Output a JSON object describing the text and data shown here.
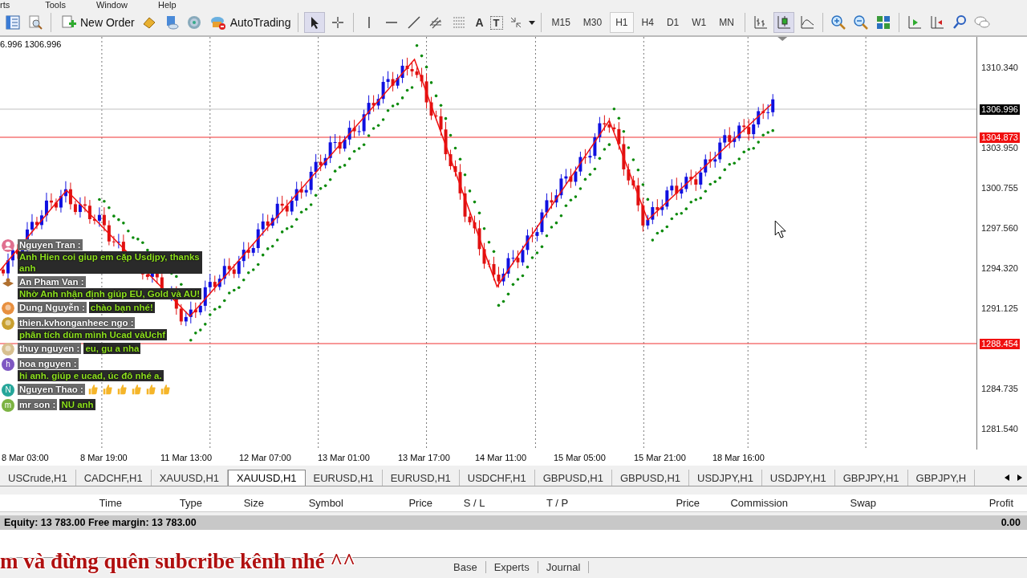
{
  "menu": [
    "rts",
    "Tools",
    "Window",
    "Help"
  ],
  "toolbar": {
    "new_order": "New Order",
    "autotrading": "AutoTrading",
    "text_tool": "A",
    "label_tool": "T",
    "timeframes": [
      {
        "label": "M15",
        "selected": false
      },
      {
        "label": "M30",
        "selected": false
      },
      {
        "label": "H1",
        "selected": true
      },
      {
        "label": "H4",
        "selected": false
      },
      {
        "label": "D1",
        "selected": false
      },
      {
        "label": "W1",
        "selected": false
      },
      {
        "label": "MN",
        "selected": false
      }
    ],
    "chart_modes": [
      {
        "kind": "bars",
        "selected": false
      },
      {
        "kind": "candles",
        "selected": true
      },
      {
        "kind": "line",
        "selected": false
      }
    ]
  },
  "chart": {
    "symbol_info": "6.996 1306.996",
    "price_labels": [
      {
        "kind": "tick",
        "text": "1310.340"
      },
      {
        "kind": "bid",
        "text": "1306.996"
      },
      {
        "kind": "level",
        "text": "1304.873"
      },
      {
        "kind": "tick",
        "text": "1303.950"
      },
      {
        "kind": "tick",
        "text": "1300.755"
      },
      {
        "kind": "tick",
        "text": "1297.560"
      },
      {
        "kind": "tick",
        "text": "1294.320"
      },
      {
        "kind": "tick",
        "text": "1291.125"
      },
      {
        "kind": "level",
        "text": "1288.454"
      },
      {
        "kind": "tick",
        "text": "1284.735"
      },
      {
        "kind": "tick",
        "text": "1281.540"
      }
    ],
    "time_labels": [
      "8 Mar 03:00",
      "8 Mar 19:00",
      "11 Mar 13:00",
      "12 Mar 07:00",
      "13 Mar 01:00",
      "13 Mar 17:00",
      "14 Mar 11:00",
      "15 Mar 05:00",
      "15 Mar 21:00",
      "18 Mar 16:00"
    ]
  },
  "chat": [
    {
      "name": "Nguyen Tran :",
      "message": "Anh Hien coi giup em cặp Usdjpy, thanks anh",
      "avatar": {
        "kind": "person",
        "color": "#e07090"
      }
    },
    {
      "name": "An Pham Van :",
      "message": "Nhờ Anh nhận định giúp EU, Gold và AU!",
      "avatar": {
        "kind": "emblem",
        "color": "#b07030"
      }
    },
    {
      "name": "Dung Nguyễn :",
      "message": "chào bạn nhé!",
      "avatar": {
        "kind": "photo",
        "color": "#e89040"
      }
    },
    {
      "name": "thien.kvhonganheec ngo :",
      "message": "phân tích dùm mình Ucad vàUchf",
      "avatar": {
        "kind": "photo",
        "color": "#c8a030"
      }
    },
    {
      "name": "thuy nguyen :",
      "message": "eu, gu a nha",
      "avatar": {
        "kind": "photo",
        "color": "#d8c090"
      }
    },
    {
      "name": "hoa nguyen :",
      "message": "hi anh. giúp e ucad, úc đô nhé a.",
      "avatar": {
        "kind": "letter",
        "initial": "h",
        "color": "#7e57c2"
      }
    },
    {
      "name": "Nguyen Thao :",
      "reactions": [
        {
          "kind": "thumbs-up"
        },
        {
          "kind": "thumbs-up"
        },
        {
          "kind": "thumbs-up"
        },
        {
          "kind": "thumbs-up"
        },
        {
          "kind": "thumbs-up"
        },
        {
          "kind": "thumbs-up"
        }
      ],
      "avatar": {
        "kind": "letter",
        "initial": "N",
        "color": "#26a69a"
      }
    },
    {
      "name": "mr son :",
      "message": "NU anh",
      "avatar": {
        "kind": "letter",
        "initial": "m",
        "color": "#7cb342"
      }
    }
  ],
  "symbol_tabs": [
    {
      "label": "USCrude,H1",
      "selected": false
    },
    {
      "label": "CADCHF,H1",
      "selected": false
    },
    {
      "label": "XAUUSD,H1",
      "selected": false
    },
    {
      "label": "XAUUSD,H1",
      "selected": true
    },
    {
      "label": "EURUSD,H1",
      "selected": false
    },
    {
      "label": "EURUSD,H1",
      "selected": false
    },
    {
      "label": "USDCHF,H1",
      "selected": false
    },
    {
      "label": "GBPUSD,H1",
      "selected": false
    },
    {
      "label": "GBPUSD,H1",
      "selected": false
    },
    {
      "label": "USDJPY,H1",
      "selected": false
    },
    {
      "label": "USDJPY,H1",
      "selected": false
    },
    {
      "label": "GBPJPY,H1",
      "selected": false
    },
    {
      "label": "GBPJPY,H",
      "selected": false
    }
  ],
  "terminal": {
    "columns": [
      "Time",
      "Type",
      "Size",
      "Symbol",
      "Price",
      "S / L",
      "T / P",
      "Price",
      "Commission",
      "Swap",
      "Profit"
    ],
    "equity": "Equity: 13 783.00  Free margin: 13 783.00",
    "profit": "0.00",
    "tabs": [
      "Base",
      "Experts",
      "Journal"
    ]
  },
  "caption": "m và đừng quên subcribe kênh nhé ^^"
}
